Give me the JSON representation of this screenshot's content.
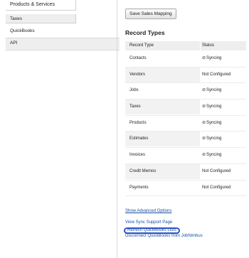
{
  "nav": {
    "items": [
      {
        "label": "Products & Services"
      },
      {
        "label": "Taxes"
      },
      {
        "label": "QuickBooks"
      },
      {
        "label": "API"
      }
    ]
  },
  "main": {
    "save_button": "Save Sales Mapping",
    "section_title": "Record Types",
    "table": {
      "headers": [
        "Record Type",
        "Status"
      ],
      "rows": [
        {
          "type": "Contacts",
          "status": "Syncing"
        },
        {
          "type": "Vendors",
          "status": "Not Configured"
        },
        {
          "type": "Jobs",
          "status": "Syncing"
        },
        {
          "type": "Taxes",
          "status": "Syncing"
        },
        {
          "type": "Products",
          "status": "Syncing"
        },
        {
          "type": "Estimates",
          "status": "Syncing"
        },
        {
          "type": "Invoices",
          "status": "Syncing"
        },
        {
          "type": "Credit Memos",
          "status": "Not Configured"
        },
        {
          "type": "Payments",
          "status": "Not Configured"
        }
      ]
    },
    "links": {
      "show_advanced": "Show Advanced Options",
      "view_sync_support": "View Sync Support Page",
      "refresh_lists": "Refresh QuickBooks Lists",
      "disconnect": "Disconnect QuickBooks from JobNimbus"
    }
  },
  "colors": {
    "link": "#1a4fa3",
    "highlight_oval": "#2d55c8"
  },
  "icons": {
    "sync": "check-icon"
  }
}
